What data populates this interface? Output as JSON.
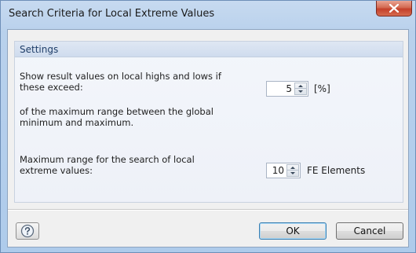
{
  "window": {
    "title": "Search Criteria for Local Extreme Values"
  },
  "settings": {
    "group_title": "Settings",
    "threshold_label_line1": "Show result values on local highs and lows if",
    "threshold_label_line2": "these exceed:",
    "threshold_value": "5",
    "threshold_unit": "[%]",
    "range_note_line1": "of the maximum range between the global",
    "range_note_line2": "minimum and maximum.",
    "search_label_line1": "Maximum range for the search of local",
    "search_label_line2": "extreme values:",
    "search_value": "10",
    "search_unit": "FE Elements"
  },
  "buttons": {
    "ok_label": "OK",
    "cancel_label": "Cancel"
  },
  "icons": {
    "close": "close-icon",
    "help": "help-icon",
    "spin_up": "spin-up-arrow-icon",
    "spin_down": "spin-down-arrow-icon"
  }
}
